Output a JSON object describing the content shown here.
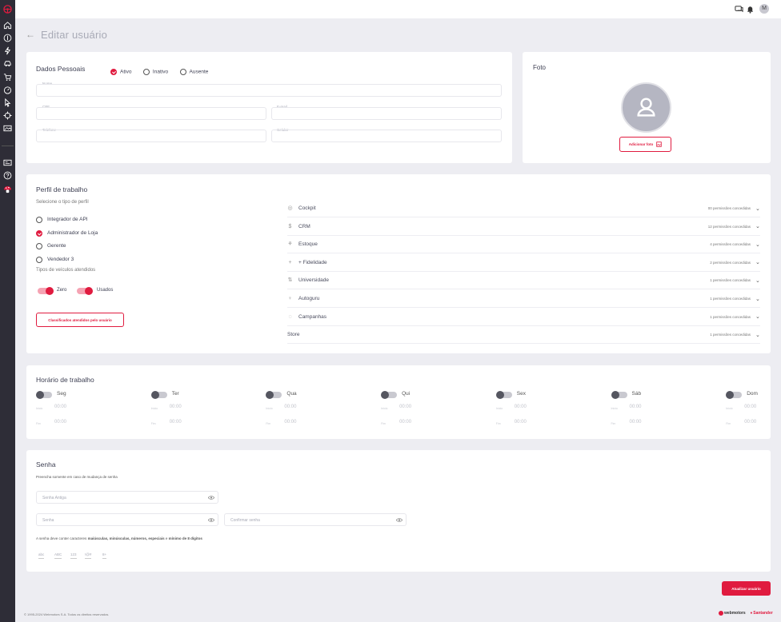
{
  "header": {
    "avatar_initial": "M"
  },
  "page": {
    "back_arrow": "←",
    "title": "Editar usuário"
  },
  "personal": {
    "title": "Dados Pessoais",
    "status": [
      {
        "label": "Ativo",
        "checked": true
      },
      {
        "label": "Inativo",
        "checked": false
      },
      {
        "label": "Ausente",
        "checked": false
      }
    ],
    "fields": {
      "name": "Nome",
      "cpf": "CPF",
      "email": "E-mail",
      "phone": "Telefone",
      "mobile": "Celular"
    }
  },
  "photo": {
    "title": "Foto",
    "add_button": "Adicionar foto"
  },
  "work_profile": {
    "title": "Perfil de trabalho",
    "select_label": "Selecione o tipo de perfil",
    "profiles": [
      {
        "label": "Integrador de API",
        "checked": false
      },
      {
        "label": "Administrador de Loja",
        "checked": true
      },
      {
        "label": "Gerente",
        "checked": false
      },
      {
        "label": "Vendedor 3",
        "checked": false
      }
    ],
    "vehicle_types_label": "Tipos de veículos atendidos",
    "vehicle_types": [
      {
        "label": "Zero",
        "on": true
      },
      {
        "label": "Usados",
        "on": true
      }
    ],
    "classified_button": "Classificados atendidos pelo usuário",
    "permissions": [
      {
        "name": "Cockpit",
        "count": "00 permissões concedidas",
        "icon": "◎"
      },
      {
        "name": "CRM",
        "count": "12 permissões concedidas",
        "icon": "$"
      },
      {
        "name": "Estoque",
        "count": "4 permissões concedidas",
        "icon": "⚘"
      },
      {
        "name": "+ Fidelidade",
        "count": "2 permissões concedidas",
        "icon": "+"
      },
      {
        "name": "Universidade",
        "count": "1 permissões concedidas",
        "icon": "⇅"
      },
      {
        "name": "Autoguru",
        "count": "1 permissões concedidas",
        "icon": "♀"
      },
      {
        "name": "Campanhas",
        "count": "1 permissões concedidas",
        "icon": "◌"
      },
      {
        "name": "Store",
        "count": "1 permissões concedidas",
        "icon": ""
      }
    ]
  },
  "schedule": {
    "title": "Horário de trabalho",
    "start_label": "Início",
    "end_label": "Fim",
    "days": [
      {
        "label": "Seg",
        "start": "00:00",
        "end": "00:00"
      },
      {
        "label": "Ter",
        "start": "00:00",
        "end": "00:00"
      },
      {
        "label": "Qua",
        "start": "00:00",
        "end": "00:00"
      },
      {
        "label": "Qui",
        "start": "00:00",
        "end": "00:00"
      },
      {
        "label": "Sex",
        "start": "00:00",
        "end": "00:00"
      },
      {
        "label": "Sáb",
        "start": "00:00",
        "end": "00:00"
      },
      {
        "label": "Dom",
        "start": "00:00",
        "end": "00:00"
      }
    ]
  },
  "password": {
    "title": "Senha",
    "hint": "Preencha somente em caso de mudança de senha",
    "old_placeholder": "Senha Antiga",
    "new_placeholder": "Senha",
    "confirm_placeholder": "Confirmar senha",
    "rule_prefix": "A senha deve conter caracteres",
    "rule_bold1": "maiúsculas, minúsculas, números, especiais",
    "rule_mid": "e",
    "rule_bold2": "mínimo de 8 dígitos",
    "rule_chips": [
      "abc",
      "ABC",
      "123",
      "!@#",
      "8+"
    ]
  },
  "actions": {
    "update_button": "Atualizar usuário"
  },
  "footer": {
    "copyright": "© 1995-2024 Webmotors S.A. Todos os direitos reservados.",
    "brand1": "webmotors",
    "brand2": "Santander"
  },
  "colors": {
    "accent": "#e01b3f",
    "sidebar": "#2e2d37",
    "background": "#ededf2"
  }
}
